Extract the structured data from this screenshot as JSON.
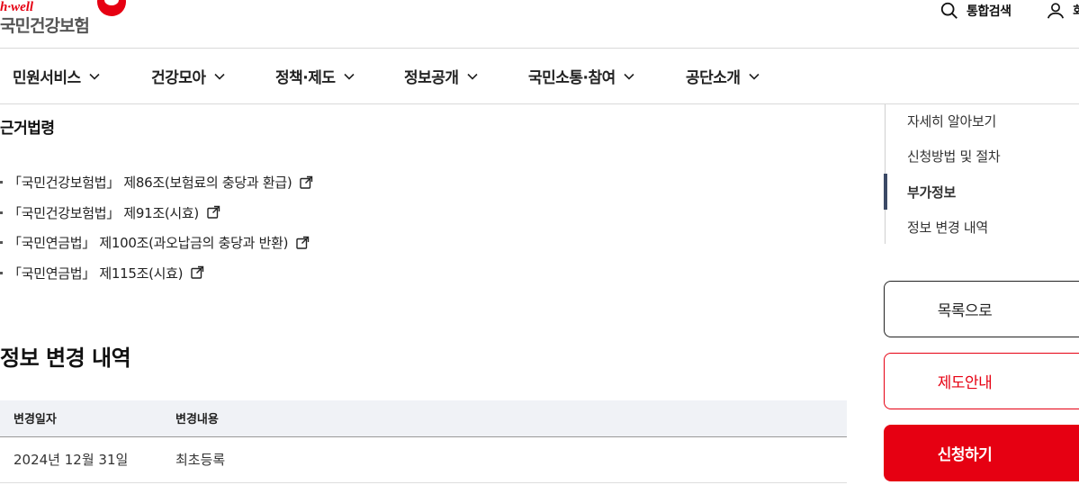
{
  "header": {
    "logo_tag": "h·well",
    "logo_text": "국민건강보험",
    "search_label": "통합검색",
    "user_label": "회"
  },
  "gnb": {
    "items": [
      {
        "label": "민원서비스"
      },
      {
        "label": "건강모아"
      },
      {
        "label": "정책·제도"
      },
      {
        "label": "정보공개"
      },
      {
        "label": "국민소통·참여"
      },
      {
        "label": "공단소개"
      }
    ]
  },
  "laws": {
    "title": "근거법령",
    "items": [
      "「국민건강보험법」 제86조(보험료의 충당과 환급)",
      "「국민건강보험법」 제91조(시효)",
      "「국민연금법」 제100조(과오납금의 충당과 반환)",
      "「국민연금법」 제115조(시효)"
    ]
  },
  "history": {
    "title": "정보 변경 내역",
    "columns": [
      "변경일자",
      "변경내용"
    ],
    "rows": [
      [
        "2024년 12월 31일",
        "최초등록"
      ]
    ]
  },
  "side_nav": {
    "items": [
      {
        "label": "자세히 알아보기",
        "active": false
      },
      {
        "label": "신청방법 및 절차",
        "active": false
      },
      {
        "label": "부가정보",
        "active": true
      },
      {
        "label": "정보 변경 내역",
        "active": false
      }
    ]
  },
  "buttons": {
    "list": "목록으로",
    "guide": "제도안내",
    "apply": "신청하기"
  },
  "colors": {
    "brand_red": "#e60012",
    "nav_active": "#3c4a66",
    "table_header_bg": "#f0f2f6"
  }
}
